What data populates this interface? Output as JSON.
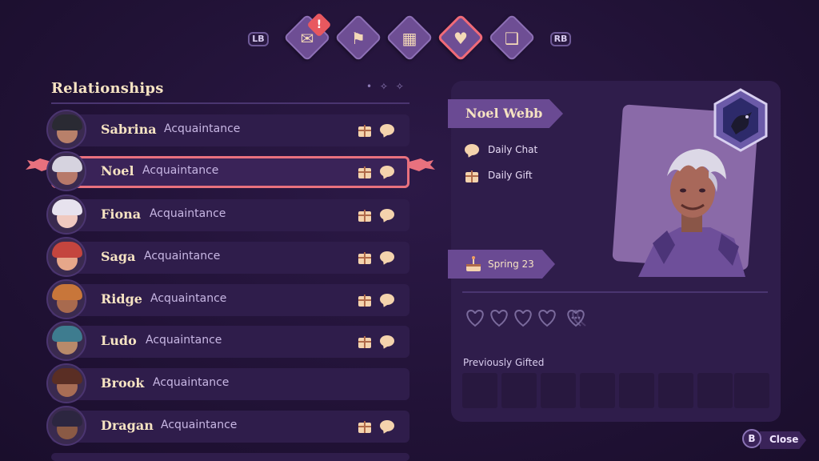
{
  "nav": {
    "left_shoulder": "LB",
    "right_shoulder": "RB",
    "tabs": [
      {
        "icon": "quest-scroll-icon",
        "glyph": "✉",
        "has_alert": true
      },
      {
        "icon": "map-icon",
        "glyph": "⚑"
      },
      {
        "icon": "calendar-icon",
        "glyph": "▦"
      },
      {
        "icon": "heart-icon",
        "glyph": "♥",
        "active": true
      },
      {
        "icon": "book-icon",
        "glyph": "❑"
      }
    ],
    "alert_mark": "!"
  },
  "relationships": {
    "title": "Relationships",
    "decoration": "• ✧ ✧",
    "rows": [
      {
        "name": "Sabrina",
        "status": "Acquaintance",
        "gift": true,
        "chat": true,
        "hair": "#2a2a33",
        "skin": "#b8806a"
      },
      {
        "name": "Noel",
        "status": "Acquaintance",
        "gift": true,
        "chat": true,
        "selected": true,
        "hair": "#d6d3df",
        "skin": "#b7796a"
      },
      {
        "name": "Fiona",
        "status": "Acquaintance",
        "gift": true,
        "chat": true,
        "hair": "#e7e2ee",
        "skin": "#f0c9c0"
      },
      {
        "name": "Saga",
        "status": "Acquaintance",
        "gift": true,
        "chat": true,
        "hair": "#c4453e",
        "skin": "#e6a78a"
      },
      {
        "name": "Ridge",
        "status": "Acquaintance",
        "gift": true,
        "chat": true,
        "hair": "#c8763a",
        "skin": "#a86a4e"
      },
      {
        "name": "Ludo",
        "status": "Acquaintance",
        "gift": true,
        "chat": true,
        "hair": "#3e7c8f",
        "skin": "#b88a6a"
      },
      {
        "name": "Brook",
        "status": "Acquaintance",
        "gift": false,
        "chat": false,
        "hair": "#5a2e24",
        "skin": "#a86d55"
      },
      {
        "name": "Dragan",
        "status": "Acquaintance",
        "gift": true,
        "chat": true,
        "hair": "#2c2640",
        "skin": "#8a5a45"
      }
    ]
  },
  "detail": {
    "name": "Noel Webb",
    "daily_chat": "Daily Chat",
    "daily_gift": "Daily Gift",
    "birthday": "Spring 23",
    "hearts_filled": 0,
    "hearts_total": 5,
    "previously_gifted_label": "Previously Gifted",
    "gift_slots": 8
  },
  "close": {
    "button": "B",
    "label": "Close"
  },
  "colors": {
    "accent": "#e9717e",
    "panel": "#2f1d4b",
    "banner": "#6a4a93",
    "text": "#f6e3c2"
  }
}
